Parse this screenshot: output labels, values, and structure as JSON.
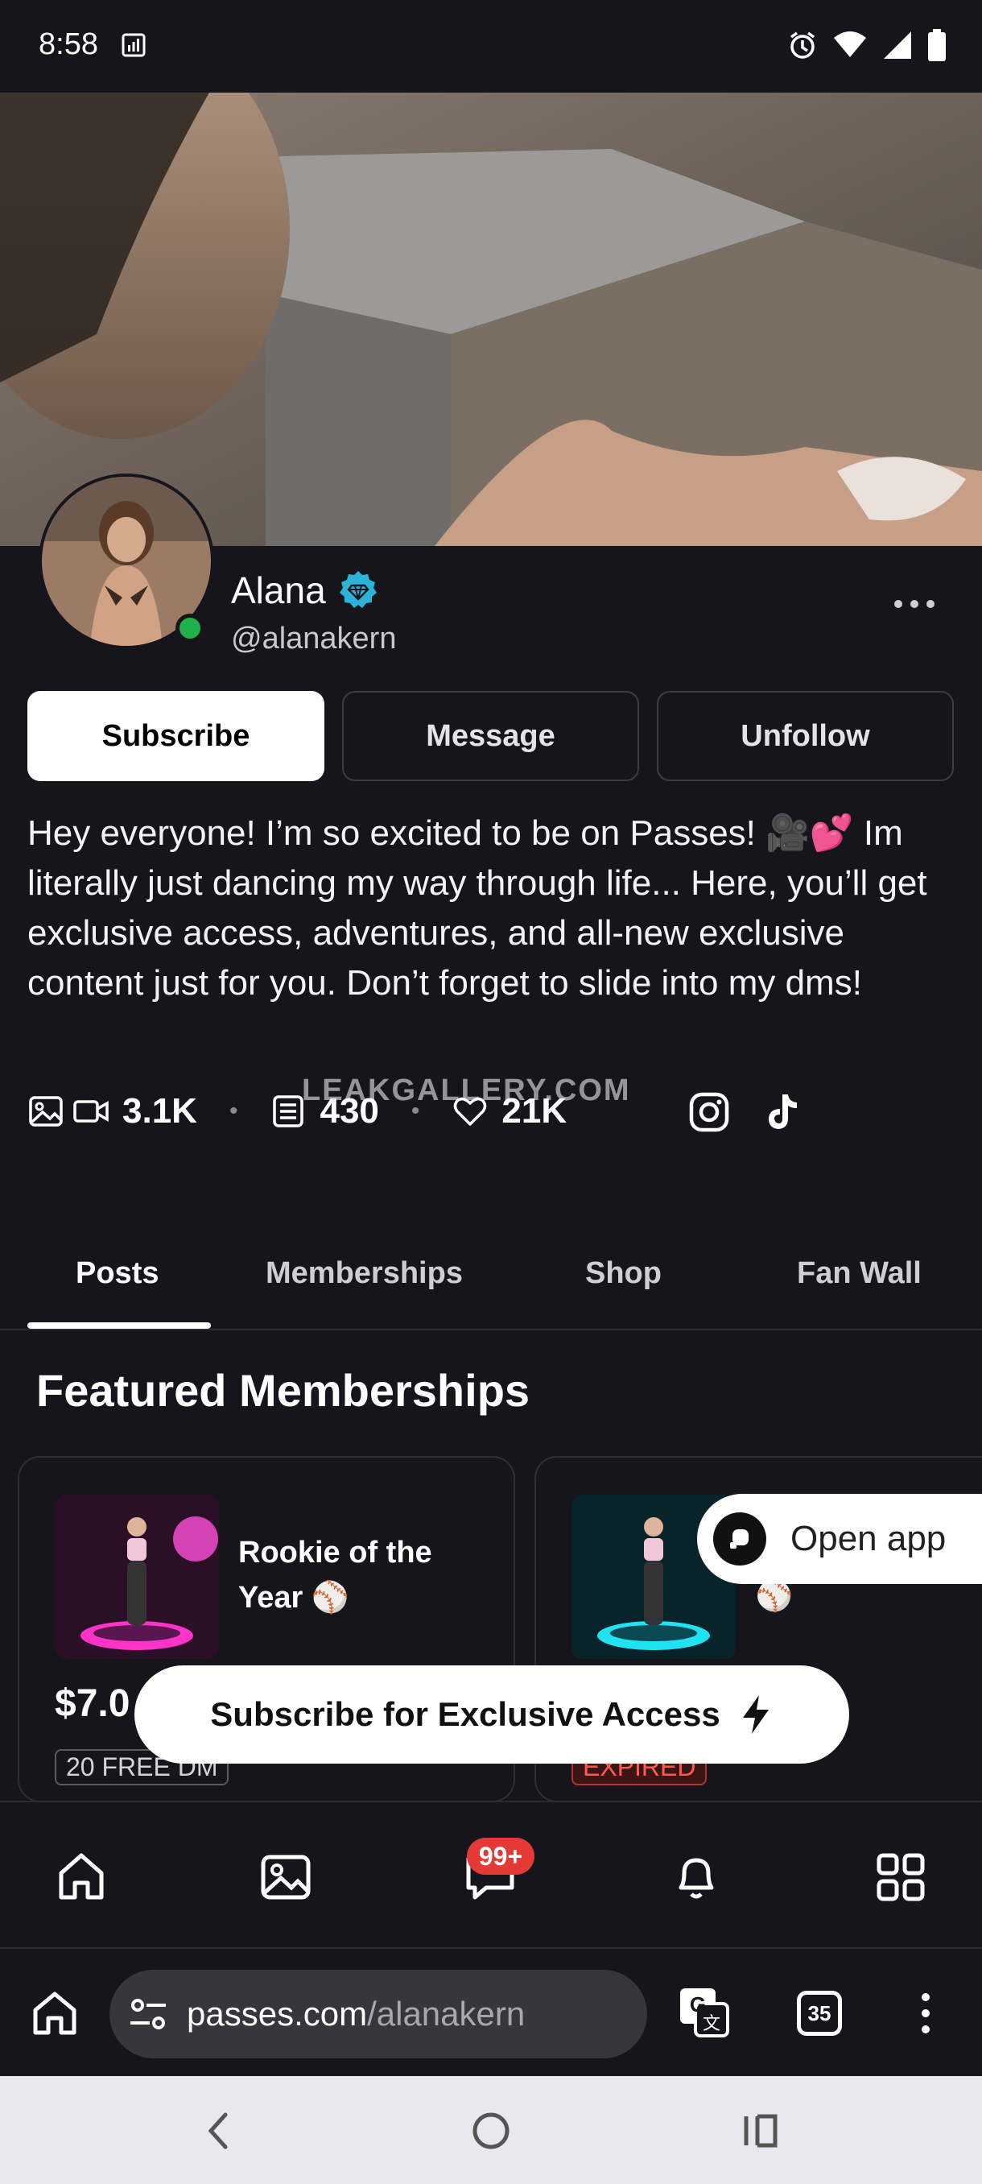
{
  "status_bar": {
    "time": "8:58"
  },
  "profile": {
    "name": "Alana",
    "handle": "@alanakern",
    "bio": "Hey everyone! I’m so excited to be on Passes! 🎥💕 Im literally just dancing my way through life... Here, you’ll get exclusive access, adventures, and all-new exclusive content just for you. Don’t forget to slide into my dms!"
  },
  "actions": {
    "subscribe": "Subscribe",
    "message": "Message",
    "unfollow": "Unfollow"
  },
  "stats": {
    "media": "3.1K",
    "posts": "430",
    "likes": "21K"
  },
  "watermark": "LEAKGALLERY.COM",
  "tabs": [
    {
      "label": "Posts",
      "active": true
    },
    {
      "label": "Memberships",
      "active": false
    },
    {
      "label": "Shop",
      "active": false
    },
    {
      "label": "Fan Wall",
      "active": false
    }
  ],
  "featured": {
    "title": "Featured Memberships",
    "cards": [
      {
        "title": "Rookie of the Year ⚾",
        "price": "$7.0",
        "badge": "20 FREE DM"
      },
      {
        "title": "⚾",
        "badge": "EXPIRED"
      }
    ]
  },
  "open_app": {
    "label": "Open app"
  },
  "cta": {
    "label": "Subscribe for Exclusive Access"
  },
  "bottom_nav": {
    "messages_badge": "99+"
  },
  "browser": {
    "url_domain": "passes.com",
    "url_path": "/alanakern",
    "tab_count": "35"
  },
  "colors": {
    "online": "#1fb24a",
    "verified": "#2bb3d9",
    "badge": "#e53935",
    "expired": "#ff5a4e"
  }
}
